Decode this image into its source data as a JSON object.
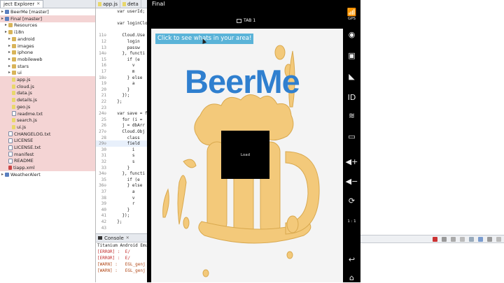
{
  "explorer": {
    "tab_label": "ject Explorer",
    "tab_close": "✕",
    "items": [
      {
        "label": "BeerMe [master]",
        "depth": 0,
        "kind": "proj",
        "selected": false
      },
      {
        "label": "Final [master]",
        "depth": 0,
        "kind": "proj",
        "selected": true
      },
      {
        "label": "Resources",
        "depth": 1,
        "kind": "folder",
        "selected": false
      },
      {
        "label": "i18n",
        "depth": 1,
        "kind": "folder",
        "selected": false
      },
      {
        "label": "android",
        "depth": 2,
        "kind": "folder",
        "selected": false
      },
      {
        "label": "images",
        "depth": 2,
        "kind": "folder",
        "selected": false
      },
      {
        "label": "iphone",
        "depth": 2,
        "kind": "folder",
        "selected": false
      },
      {
        "label": "mobileweb",
        "depth": 2,
        "kind": "folder",
        "selected": false
      },
      {
        "label": "stars",
        "depth": 2,
        "kind": "folder",
        "selected": false
      },
      {
        "label": "ui",
        "depth": 2,
        "kind": "folder",
        "selected": false
      },
      {
        "label": "app.js",
        "depth": 2,
        "kind": "jsf",
        "selected": true
      },
      {
        "label": "cloud.js",
        "depth": 2,
        "kind": "jsf",
        "selected": true
      },
      {
        "label": "data.js",
        "depth": 2,
        "kind": "jsf",
        "selected": true
      },
      {
        "label": "details.js",
        "depth": 2,
        "kind": "jsf",
        "selected": true
      },
      {
        "label": "geo.js",
        "depth": 2,
        "kind": "jsf",
        "selected": true
      },
      {
        "label": "readme.txt",
        "depth": 2,
        "kind": "file",
        "selected": true
      },
      {
        "label": "search.js",
        "depth": 2,
        "kind": "jsf",
        "selected": true
      },
      {
        "label": "ui.js",
        "depth": 2,
        "kind": "jsf",
        "selected": true
      },
      {
        "label": "CHANGELOG.txt",
        "depth": 1,
        "kind": "file",
        "selected": true
      },
      {
        "label": "LICENSE",
        "depth": 1,
        "kind": "file",
        "selected": true
      },
      {
        "label": "LICENSE.txt",
        "depth": 1,
        "kind": "file",
        "selected": true
      },
      {
        "label": "manifest",
        "depth": 1,
        "kind": "file",
        "selected": true
      },
      {
        "label": "README",
        "depth": 1,
        "kind": "file",
        "selected": true
      },
      {
        "label": "tiapp.xml",
        "depth": 1,
        "kind": "xml",
        "selected": true
      },
      {
        "label": "WeatherAlert",
        "depth": 0,
        "kind": "proj",
        "selected": false
      }
    ]
  },
  "editor": {
    "tabs": [
      {
        "label": "app.js"
      },
      {
        "label": "deta"
      }
    ],
    "lines": [
      {
        "n": "",
        "text": "  var userId;"
      },
      {
        "n": "",
        "text": ""
      },
      {
        "n": "",
        "text": "  var loginCloud"
      },
      {
        "n": "",
        "text": ""
      },
      {
        "n": "11⊖",
        "text": "    Cloud.Use"
      },
      {
        "n": "12",
        "text": "      login"
      },
      {
        "n": "13",
        "text": "      passw"
      },
      {
        "n": "14⊖",
        "text": "    }, functi"
      },
      {
        "n": "15",
        "text": "      if (e"
      },
      {
        "n": "16",
        "text": "        v"
      },
      {
        "n": "17",
        "text": "        m"
      },
      {
        "n": "18⊖",
        "text": "      } else"
      },
      {
        "n": "19",
        "text": "        a"
      },
      {
        "n": "20",
        "text": "      }"
      },
      {
        "n": "21",
        "text": "    });"
      },
      {
        "n": "22",
        "text": "  };"
      },
      {
        "n": "23",
        "text": ""
      },
      {
        "n": "24⊖",
        "text": "  var save = fu"
      },
      {
        "n": "25",
        "text": "    for (i ="
      },
      {
        "n": "26",
        "text": "    j = dbArr"
      },
      {
        "n": "27⊖",
        "text": "    Cloud.Obj"
      },
      {
        "n": "28",
        "text": "      class"
      },
      {
        "n": "29⊖",
        "text": "      field"
      },
      {
        "n": "30",
        "text": "        i"
      },
      {
        "n": "31",
        "text": "        s"
      },
      {
        "n": "32",
        "text": "        s"
      },
      {
        "n": "33",
        "text": "      }"
      },
      {
        "n": "34⊖",
        "text": "    }, functi"
      },
      {
        "n": "35",
        "text": "      if (e"
      },
      {
        "n": "36⊖",
        "text": "      } else"
      },
      {
        "n": "37",
        "text": "        a"
      },
      {
        "n": "38",
        "text": "        v"
      },
      {
        "n": "39",
        "text": "        r"
      },
      {
        "n": "40",
        "text": "      }"
      },
      {
        "n": "41",
        "text": "    });"
      },
      {
        "n": "42",
        "text": "  };"
      },
      {
        "n": "43",
        "text": ""
      }
    ]
  },
  "console": {
    "tab_label": "Console",
    "tab_close": "✕",
    "lines": [
      {
        "text": "Titanium Android Emulat",
        "kind": "info"
      },
      {
        "text": "[ERROR] :  E/",
        "kind": "err"
      },
      {
        "text": "[ERROR] :  E/",
        "kind": "err"
      },
      {
        "text": "[WARN] :   EGL_genj",
        "kind": "warn"
      },
      {
        "text": "[WARN] :   EGL_genj",
        "kind": "warn"
      }
    ]
  },
  "emulator": {
    "window_title": "Final",
    "tab_label": "TAB 1",
    "button_label": "Click to see whats in your area!",
    "brand_title": "BeerMe",
    "loader_text": "Load",
    "colors": {
      "brand": "#2f7fcf",
      "button": "#5ab3d8",
      "beer": "#f3c97a"
    },
    "controls": [
      {
        "name": "gps-control",
        "glyph": "📶",
        "label": "GPS"
      },
      {
        "name": "camera-control",
        "glyph": "◉",
        "label": ""
      },
      {
        "name": "media-control",
        "glyph": "▣",
        "label": ""
      },
      {
        "name": "network-control",
        "glyph": "◣",
        "label": ""
      },
      {
        "name": "id-control",
        "glyph": "ID",
        "label": ""
      },
      {
        "name": "rss-control",
        "glyph": "≋",
        "label": ""
      },
      {
        "name": "sms-control",
        "glyph": "▭",
        "label": ""
      },
      {
        "name": "volume-up-control",
        "glyph": "◀+",
        "label": ""
      },
      {
        "name": "volume-down-control",
        "glyph": "◀−",
        "label": ""
      },
      {
        "name": "rotate-control",
        "glyph": "⟳",
        "label": ""
      },
      {
        "name": "scale-control",
        "glyph": "",
        "label": "1 : 1"
      },
      {
        "name": "back-control",
        "glyph": "↩",
        "label": ""
      },
      {
        "name": "home-control",
        "glyph": "⌂",
        "label": ""
      }
    ]
  }
}
